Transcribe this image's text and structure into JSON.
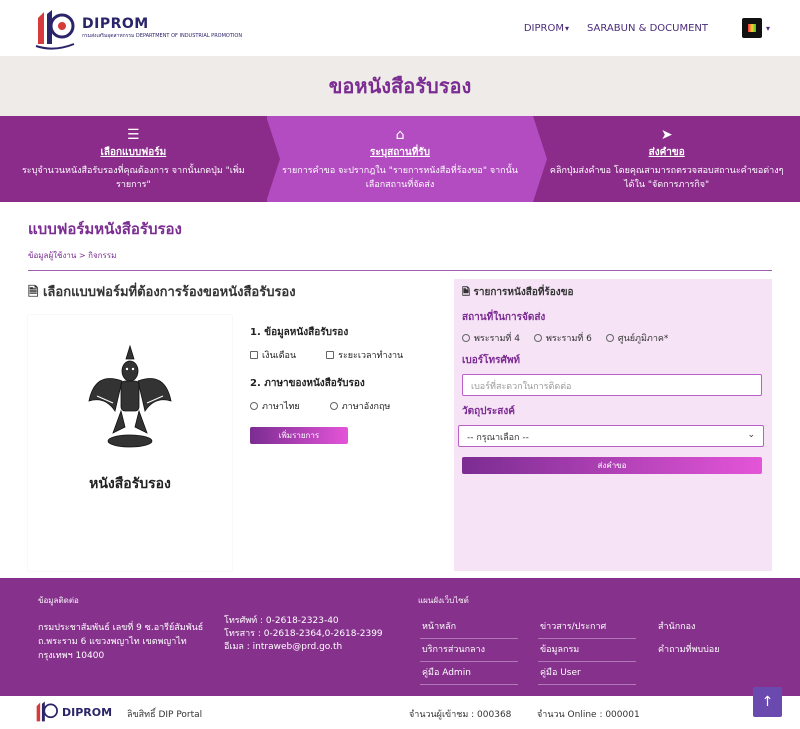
{
  "nav": {
    "brand": "DIPROM",
    "brand_sub": "กรมส่งเสริมอุตสาหกรรม DEPARTMENT OF INDUSTRIAL PROMOTION",
    "link1": "DIPROM",
    "link2": "SARABUN & DOCUMENT"
  },
  "page_title": "ขอหนังสือรับรอง",
  "steps": [
    {
      "icon": "☰",
      "title": "เลือกแบบฟอร์ม",
      "desc": "ระบุจำนวนหนังสือรับรองที่คุณต้องการ จากนั้นกดปุ่ม \"เพิ่มรายการ\""
    },
    {
      "icon": "⌂",
      "title": "ระบุสถานที่รับ",
      "desc": "รายการคำขอ จะปรากฎใน \"รายการหนังสือที่ร้องขอ\" จากนั้นเลือกสถานที่จัดส่ง"
    },
    {
      "icon": "➤",
      "title": "ส่งคำขอ",
      "desc": "คลิกปุ่มส่งคำขอ โดยคุณสามารถตรวจสอบสถานะคำขอต่างๆได้ใน \"จัดการภารกิจ\""
    }
  ],
  "form_title": "แบบฟอร์มหนังสือรับรอง",
  "breadcrumb": "ข้อมูลผู้ใช้งาน > กิจกรรม",
  "left": {
    "heading": "เลือกแบบฟอร์มที่ต้องการร้องขอหนังสือรับรอง",
    "card_caption": "หนังสือรับรอง",
    "section1": "1. ข้อมูลหนังสือรับรอง",
    "opt_salary": "เงินเดือน",
    "opt_period": "ระยะเวลาทำงาน",
    "section2": "2. ภาษาของหนังสือรับรอง",
    "opt_thai": "ภาษาไทย",
    "opt_eng": "ภาษาอังกฤษ",
    "add_button": "เพิ่มรายการ"
  },
  "right": {
    "heading": "รายการหนังสือที่ร้องขอ",
    "place_label": "สถานที่ในการจัดส่ง",
    "places": [
      "พระรามที่ 4",
      "พระรามที่ 6",
      "ศูนย์ภูมิภาค*"
    ],
    "phone_label": "เบอร์โทรศัพท์",
    "phone_placeholder": "เบอร์ที่สะดวกในการติดต่อ",
    "purpose_label": "วัตถุประสงค์",
    "purpose_value": "-- กรุณาเลือก --",
    "send_button": "ส่งคำขอ"
  },
  "footer": {
    "contact_head": "ข้อมูลติดต่อ",
    "addr1": "กรมประชาสัมพันธ์ เลขที่ 9 ซ.อารีย์สัมพันธ์",
    "addr2": "ถ.พระราม 6 แขวงพญาไท เขตพญาไท",
    "addr3": "กรุงเทพฯ 10400",
    "tel": "โทรศัพท์ : 0-2618-2323-40",
    "fax": "โทรสาร : 0-2618-2364,0-2618-2399",
    "email": "อีเมล : intraweb@prd.go.th",
    "sitemap_head": "แผนผังเว็บไซต์",
    "links": [
      "หน้าหลัก",
      "ข่าวสาร/ประกาศ",
      "สำนักกอง",
      "บริการส่วนกลาง",
      "ข้อมูลกรม",
      "คำถามที่พบบ่อย",
      "คู่มือ Admin",
      "คู่มือ User",
      ""
    ]
  },
  "bottom": {
    "copyright": "ลิขสิทธิ์ DIP Portal",
    "visitors": "จำนวนผู้เข้าชม : 000368",
    "online": "จำนวน Online : 000001"
  }
}
